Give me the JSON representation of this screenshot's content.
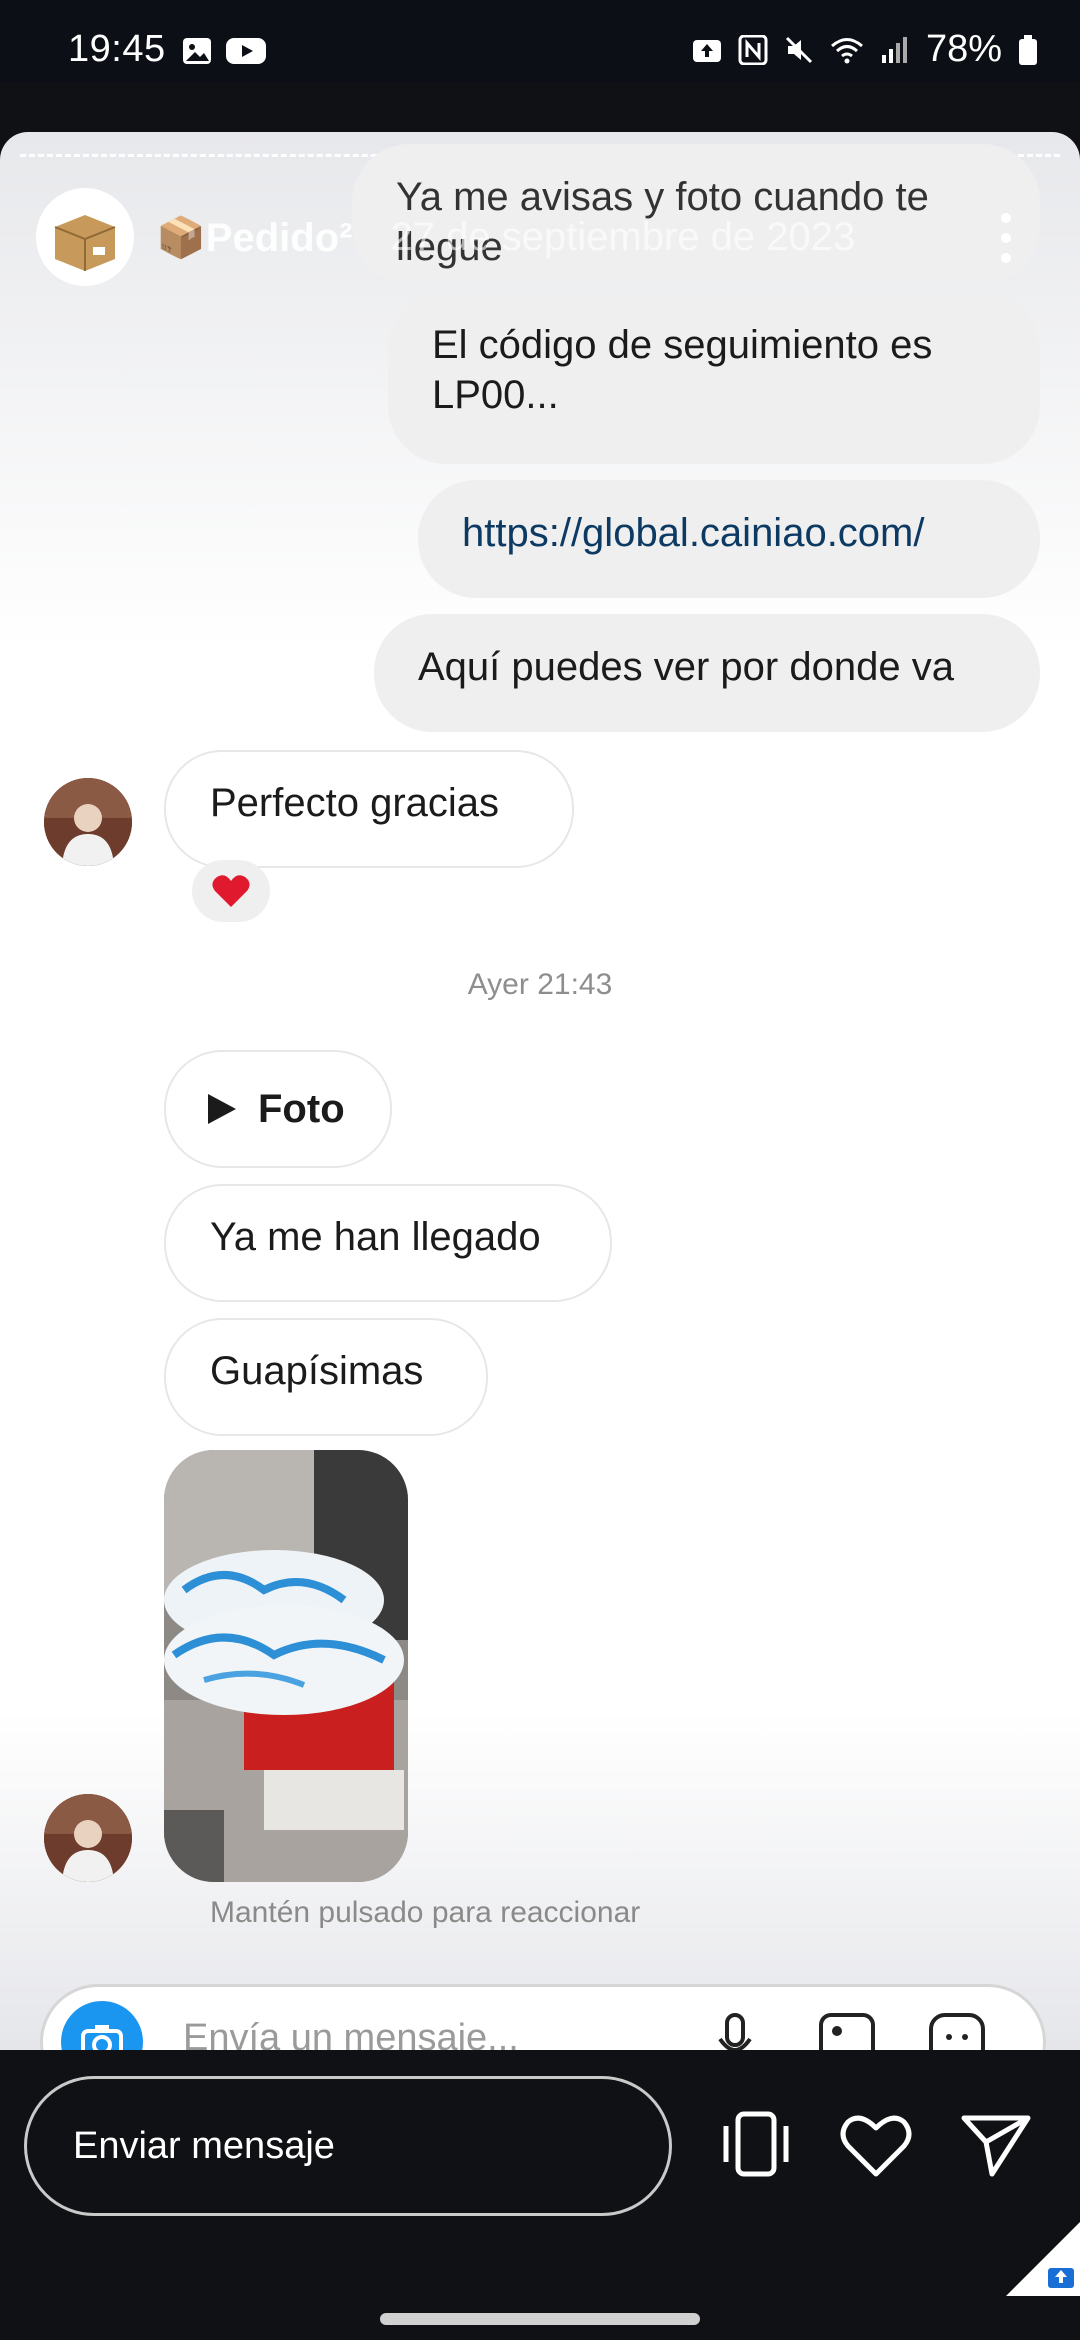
{
  "status_bar": {
    "time": "19:45",
    "battery": "78%"
  },
  "story_header": {
    "name": "📦Pedido²",
    "date": "27 de septiembre de 2023"
  },
  "messages": {
    "m0": "Ya me avisas y foto cuando te llegue",
    "m1": "El código de seguimiento es LP00...",
    "m2": "https://global.cainiao.com/",
    "m3": "Aquí puedes ver por donde va",
    "m4": "Perfecto gracias",
    "m5_label": "Foto",
    "m6": "Ya me han llegado",
    "m7": "Guapísimas"
  },
  "reaction": "❤️",
  "timestamp": "Ayer 21:43",
  "hint": "Mantén pulsado para reaccionar",
  "composer_placeholder": "Envía un mensaje...",
  "bottom": {
    "message_placeholder": "Enviar mensaje"
  },
  "colors": {
    "link": "#0c3a63",
    "heart": "#e0192e",
    "accent": "#1a95f0"
  },
  "icons": [
    "picture-icon",
    "youtube-icon",
    "upload-icon",
    "nfc-icon",
    "mute-icon",
    "wifi-icon",
    "signal-icon",
    "battery-icon",
    "more-icon",
    "play-icon",
    "camera-icon",
    "mic-icon",
    "gallery-icon",
    "sticker-icon",
    "vibrate-icon",
    "heart-icon",
    "send-icon"
  ]
}
